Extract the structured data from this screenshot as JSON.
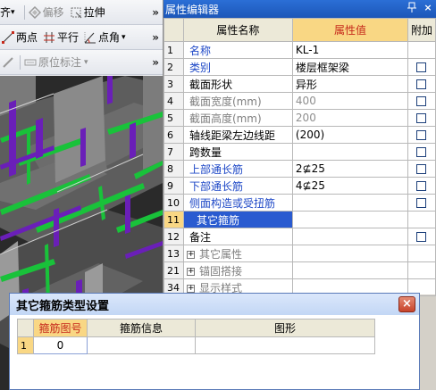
{
  "toolbar": {
    "row1": {
      "item1_label": "齐",
      "item2_label": "偏移",
      "item3_label": "拉伸",
      "overflow": "»"
    },
    "row2": {
      "item1_label": "两点",
      "item2_label": "平行",
      "item3_label": "点角",
      "item3_arrow": "▾",
      "overflow": "»"
    },
    "row3": {
      "item1_label": "原位标注",
      "item1_arrow": "▾",
      "overflow": "»"
    }
  },
  "property_editor": {
    "title": "属性编辑器",
    "pin_icon": "ㅁ",
    "close_icon": "×",
    "columns": [
      "属性名称",
      "属性值",
      "附加"
    ],
    "rows": [
      {
        "num": "1",
        "name": "名称",
        "value": "KL-1",
        "has_check": false
      },
      {
        "num": "2",
        "name": "类别",
        "value": "楼层框架梁",
        "has_check": true
      },
      {
        "num": "3",
        "name": "截面形状",
        "value": "异形",
        "has_check": true
      },
      {
        "num": "4",
        "name": "截面宽度(mm)",
        "value": "400",
        "has_check": true
      },
      {
        "num": "5",
        "name": "截面高度(mm)",
        "value": "200",
        "has_check": true
      },
      {
        "num": "6",
        "name": "轴线距梁左边线距",
        "value": "(200)",
        "has_check": true
      },
      {
        "num": "7",
        "name": "跨数量",
        "value": "",
        "has_check": true
      },
      {
        "num": "8",
        "name": "上部通长筋",
        "value": "2⊈25",
        "has_check": true
      },
      {
        "num": "9",
        "name": "下部通长筋",
        "value": "4⊈25",
        "has_check": true
      },
      {
        "num": "10",
        "name": "侧面构造或受扭筋",
        "value": "",
        "has_check": true
      },
      {
        "num": "11",
        "name": "其它箍筋",
        "value": "",
        "has_check": false
      },
      {
        "num": "12",
        "name": "备注",
        "value": "",
        "has_check": true
      },
      {
        "num": "13",
        "name": "其它属性",
        "value": "",
        "has_check": false
      },
      {
        "num": "21",
        "name": "锚固搭接",
        "value": "",
        "has_check": false
      },
      {
        "num": "34",
        "name": "显示样式",
        "value": "",
        "has_check": false
      }
    ],
    "selected_row_num": "11"
  },
  "dialog": {
    "title": "其它箍筋类型设置",
    "close_icon": "×",
    "columns": [
      "箍筋图号",
      "箍筋信息",
      "图形"
    ],
    "rows": [
      {
        "num": "1",
        "figure_no": "0",
        "info": "",
        "shape": ""
      }
    ]
  },
  "colors": {
    "title_bar_blue": "#1c56b8",
    "selected_row_blue": "#2a5bd0",
    "header_highlight": "#f9d784",
    "header_text_red": "#c62a1c",
    "name_blue": "#1f49c7",
    "viewport_green": "#19c23a",
    "viewport_purple": "#6a1fb8"
  }
}
